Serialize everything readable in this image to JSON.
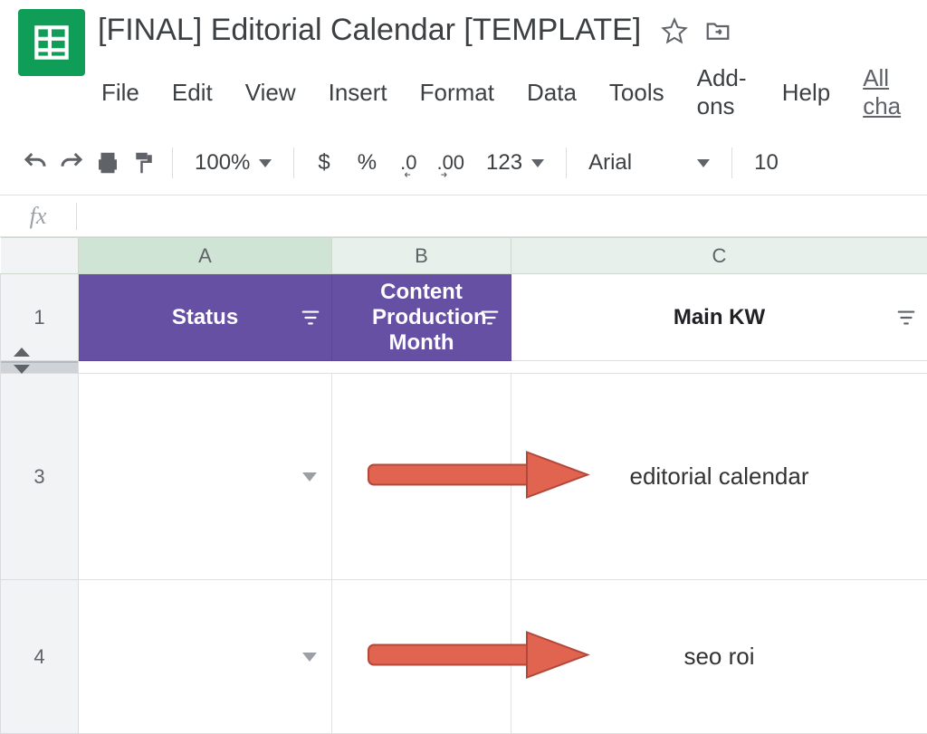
{
  "title": "[FINAL] Editorial Calendar [TEMPLATE]",
  "menubar": {
    "file": "File",
    "edit": "Edit",
    "view": "View",
    "insert": "Insert",
    "format": "Format",
    "data": "Data",
    "tools": "Tools",
    "addons": "Add-ons",
    "help": "Help",
    "allcha": "All cha"
  },
  "toolbar": {
    "zoom": "100%",
    "currency": "$",
    "percent": "%",
    "dec_dec": ".0",
    "dec_inc": ".00",
    "numfmt": "123",
    "font": "Arial",
    "fontsize": "10"
  },
  "fx_label": "fx",
  "fx_value": "",
  "columns": {
    "A": "A",
    "B": "B",
    "C": "C"
  },
  "headers": {
    "status": "Status",
    "content_month": "Content Production Month",
    "main_kw": "Main KW"
  },
  "rows": [
    {
      "num": "1"
    },
    {
      "num": "3",
      "status": "",
      "month": "",
      "kw": "editorial calendar"
    },
    {
      "num": "4",
      "status": "",
      "month": "",
      "kw": "seo roi"
    }
  ],
  "colors": {
    "header_bg": "#6650a4",
    "arrow": "#e06450"
  }
}
